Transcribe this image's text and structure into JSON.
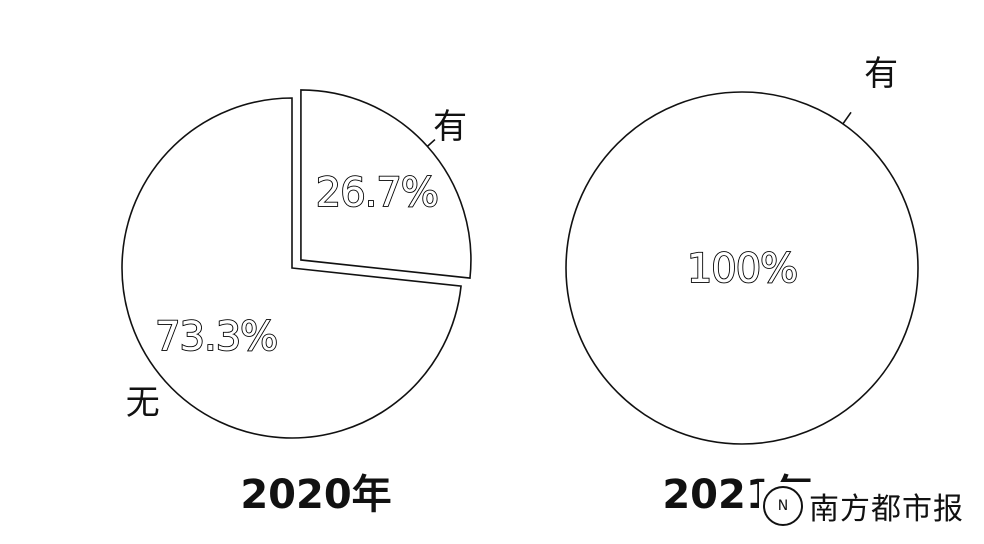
{
  "chart_data": [
    {
      "type": "pie",
      "caption": "2020年",
      "slices": [
        {
          "label": "有",
          "value": 26.7,
          "value_label": "26.7%",
          "exploded": true
        },
        {
          "label": "无",
          "value": 73.3,
          "value_label": "73.3%",
          "exploded": false
        }
      ],
      "colors": {
        "fill": "#ffffff",
        "stroke": "#111111"
      }
    },
    {
      "type": "pie",
      "caption": "2021年",
      "slices": [
        {
          "label": "有",
          "value": 100,
          "value_label": "100%",
          "exploded": false
        }
      ],
      "colors": {
        "fill": "#ffffff",
        "stroke": "#111111"
      }
    }
  ],
  "watermark": {
    "icon": "N",
    "text": "南方都市报"
  }
}
